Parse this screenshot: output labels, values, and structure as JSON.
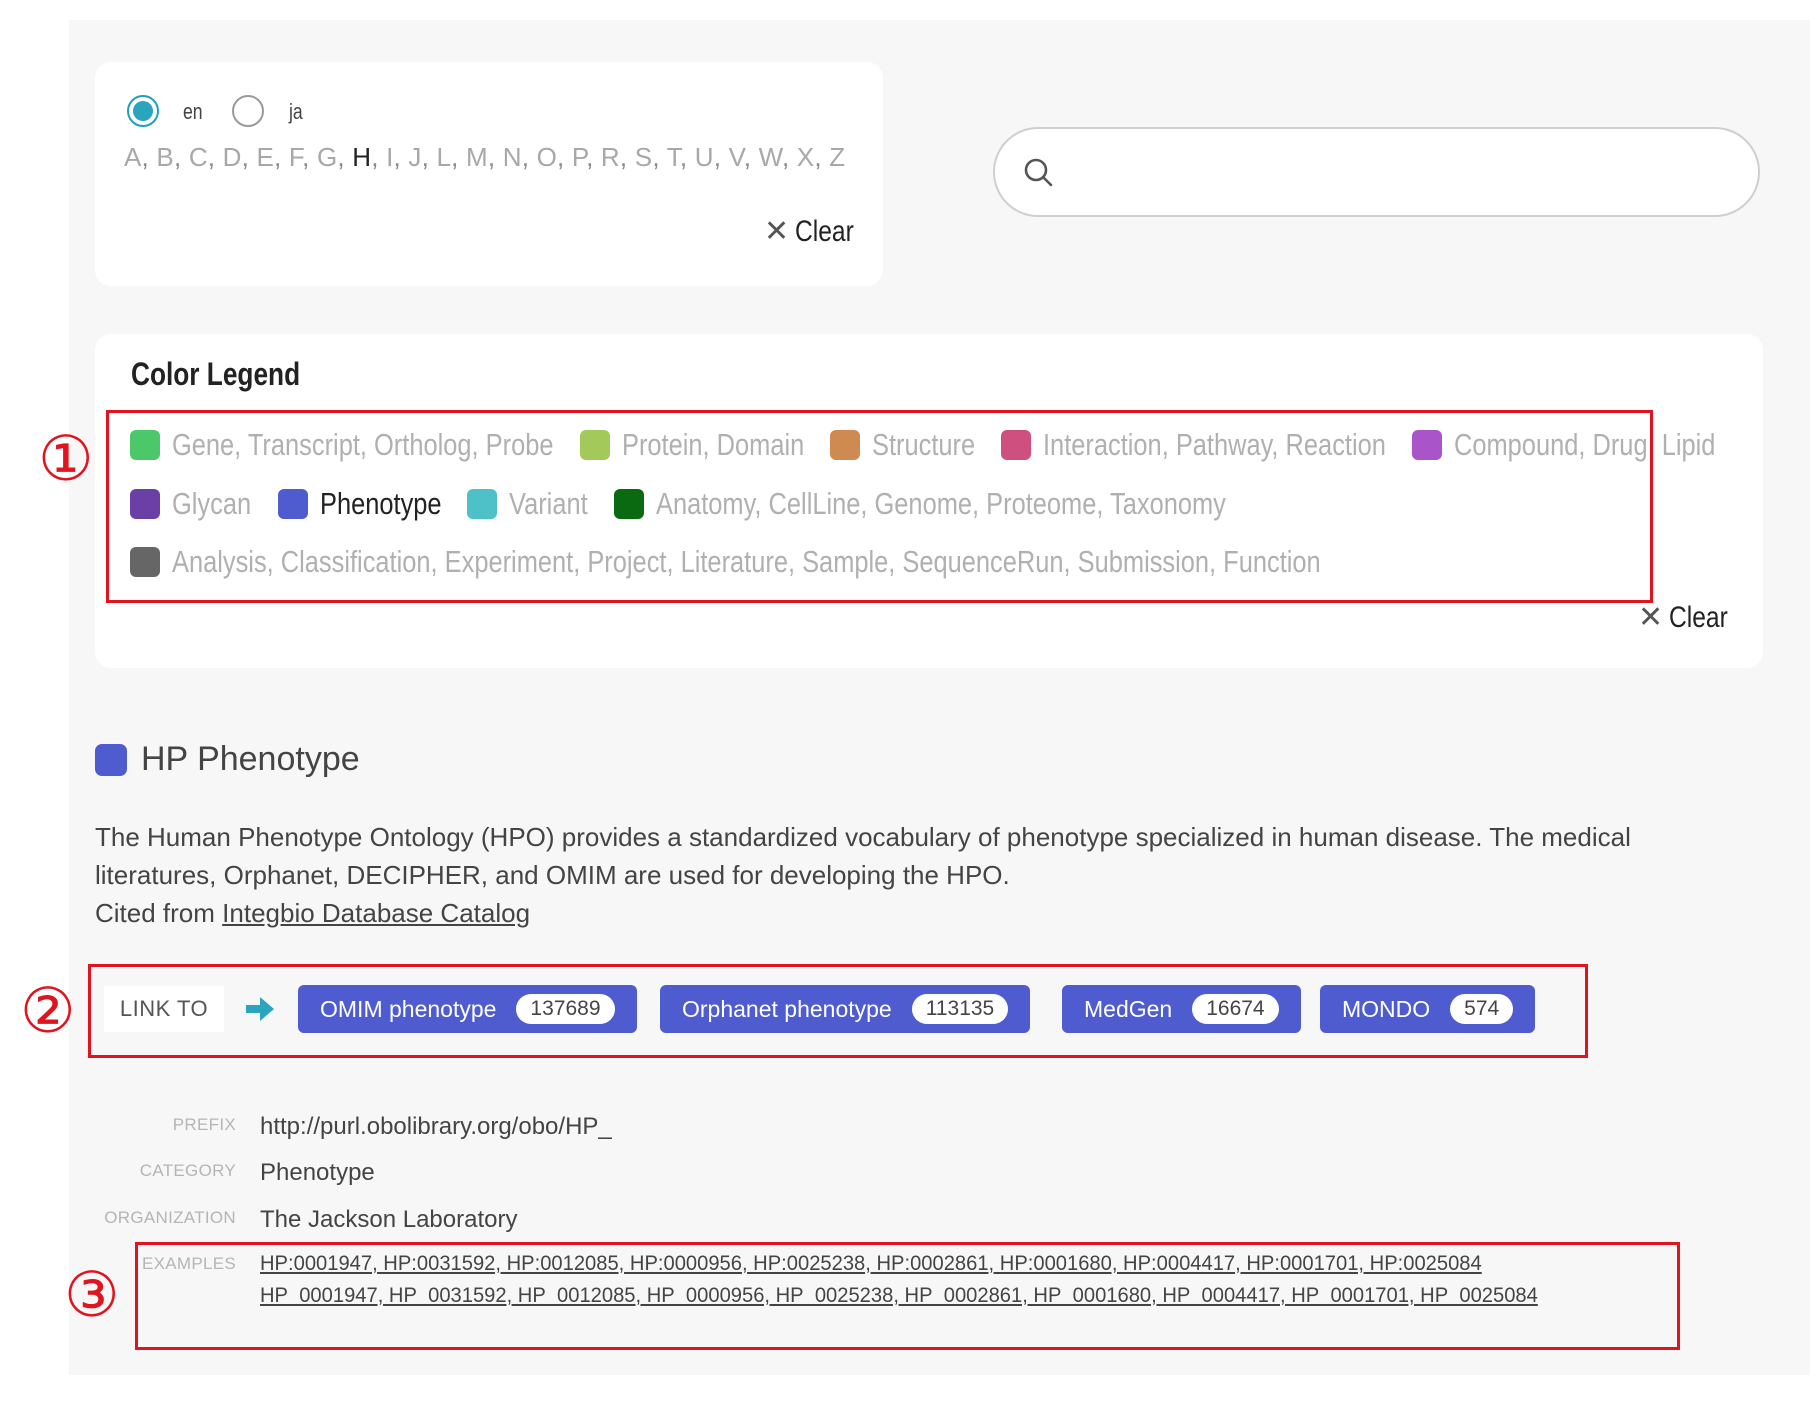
{
  "language": {
    "options": [
      {
        "label": "en",
        "checked": true
      },
      {
        "label": "ja",
        "checked": false
      }
    ]
  },
  "alphabet": {
    "letters": [
      "A",
      "B",
      "C",
      "D",
      "E",
      "F",
      "G",
      "H",
      "I",
      "J",
      "L",
      "M",
      "N",
      "O",
      "P",
      "R",
      "S",
      "T",
      "U",
      "V",
      "W",
      "X",
      "Z"
    ],
    "active": "H"
  },
  "clear_label": "Clear",
  "search": {
    "placeholder": ""
  },
  "legend": {
    "title": "Color Legend",
    "rows": [
      [
        {
          "color": "#4cc86b",
          "words": [
            "Gene",
            "Transcript",
            "Ortholog",
            "Probe"
          ],
          "active": false
        },
        {
          "color": "#a3c95a",
          "words": [
            "Protein",
            "Domain"
          ],
          "active": false
        },
        {
          "color": "#cf8a52",
          "words": [
            "Structure"
          ],
          "active": false
        },
        {
          "color": "#cf4f7e",
          "words": [
            "Interaction",
            "Pathway",
            "Reaction"
          ],
          "active": false
        },
        {
          "color": "#a955c9",
          "words": [
            "Compound",
            "Drug",
            "Lipid"
          ],
          "active": false
        }
      ],
      [
        {
          "color": "#6a3fa6",
          "words": [
            "Glycan"
          ],
          "active": false
        },
        {
          "color": "#4e5ccf",
          "words": [
            "Phenotype"
          ],
          "active": true
        },
        {
          "color": "#4dc1c7",
          "words": [
            "Variant"
          ],
          "active": false
        },
        {
          "color": "#0a6a12",
          "words": [
            "Anatomy",
            "CellLine",
            "Genome",
            "Proteome",
            "Taxonomy"
          ],
          "active": false
        }
      ],
      [
        {
          "color": "#666666",
          "words": [
            "Analysis",
            "Classification",
            "Experiment",
            "Project",
            "Literature",
            "Sample",
            "SequenceRun",
            "Submission",
            "Function"
          ],
          "active": false
        }
      ]
    ]
  },
  "annotations": [
    "①",
    "②",
    "③"
  ],
  "dataset": {
    "color": "#4e5ccf",
    "title": "HP Phenotype",
    "description": "The Human Phenotype Ontology (HPO) provides a standardized vocabulary of phenotype specialized in human disease. The medical literatures, Orphanet, DECIPHER, and OMIM are used for developing the HPO.",
    "cited_prefix": "Cited from ",
    "cited_link": "Integbio Database Catalog",
    "link_to_label": "LINK TO",
    "links": [
      {
        "label": "OMIM phenotype",
        "count": "137689"
      },
      {
        "label": "Orphanet phenotype",
        "count": "113135"
      },
      {
        "label": "MedGen",
        "count": "16674"
      },
      {
        "label": "MONDO",
        "count": "574"
      }
    ],
    "meta": {
      "prefix_key": "PREFIX",
      "prefix": "http://purl.obolibrary.org/obo/HP_",
      "category_key": "CATEGORY",
      "category": "Phenotype",
      "organization_key": "ORGANIZATION",
      "organization": "The Jackson Laboratory",
      "examples_key": "EXAMPLES",
      "examples_line1": "HP:0001947, HP:0031592, HP:0012085, HP:0000956, HP:0025238, HP:0002861, HP:0001680, HP:0004417, HP:0001701, HP:0025084",
      "examples_line2": "HP_0001947, HP_0031592, HP_0012085, HP_0000956, HP_0025238, HP_0002861, HP_0001680, HP_0004417, HP_0001701, HP_0025084"
    }
  }
}
